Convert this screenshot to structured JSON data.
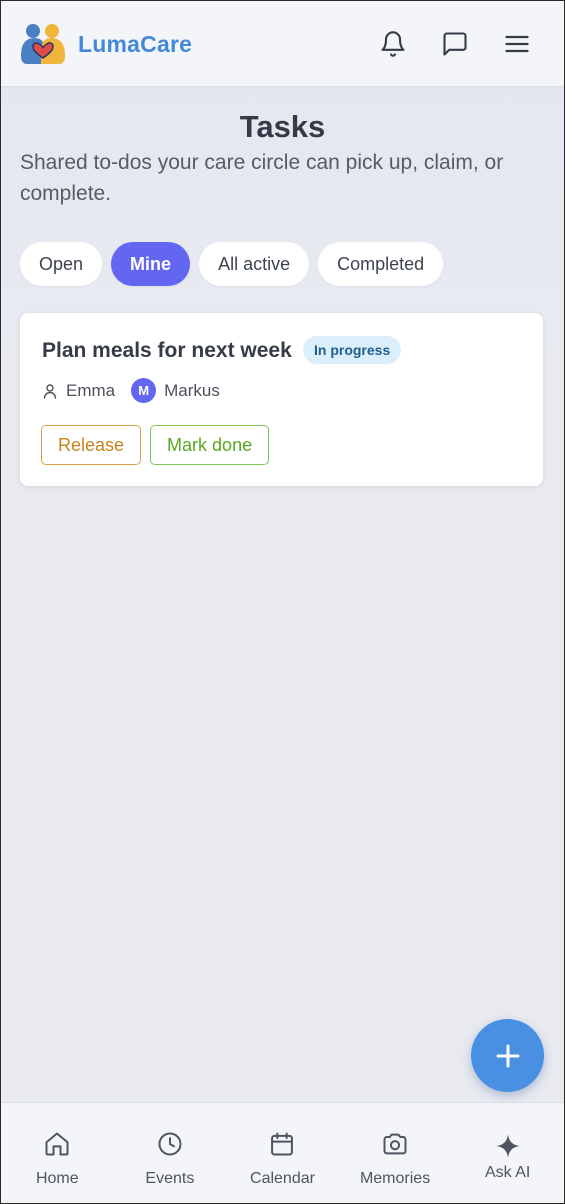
{
  "app": {
    "brand": "LumaCare"
  },
  "header": {
    "icons": [
      "bell-icon",
      "message-icon",
      "menu-icon"
    ]
  },
  "page": {
    "title": "Tasks",
    "subtitle": "Shared to-dos your care circle can pick up, claim, or complete."
  },
  "filters": [
    {
      "label": "Open",
      "active": false
    },
    {
      "label": "Mine",
      "active": true
    },
    {
      "label": "All active",
      "active": false
    },
    {
      "label": "Completed",
      "active": false
    }
  ],
  "tasks": [
    {
      "title": "Plan meals for next week",
      "status": "In progress",
      "assignee": "Emma",
      "claimer_initial": "M",
      "claimer": "Markus",
      "actions": {
        "release": "Release",
        "done": "Mark done"
      }
    }
  ],
  "fab": {
    "icon": "plus-icon"
  },
  "bottom_nav": [
    {
      "label": "Home",
      "icon": "home-icon"
    },
    {
      "label": "Events",
      "icon": "clock-icon"
    },
    {
      "label": "Calendar",
      "icon": "calendar-icon"
    },
    {
      "label": "Memories",
      "icon": "camera-icon"
    },
    {
      "label": "Ask AI",
      "icon": "sparkle-icon"
    }
  ],
  "colors": {
    "brand": "#4289d8",
    "accent": "#6366f1",
    "fab": "#4a90e2",
    "release": "#c98219",
    "done": "#58a824",
    "status_bg": "#dbeefc"
  }
}
